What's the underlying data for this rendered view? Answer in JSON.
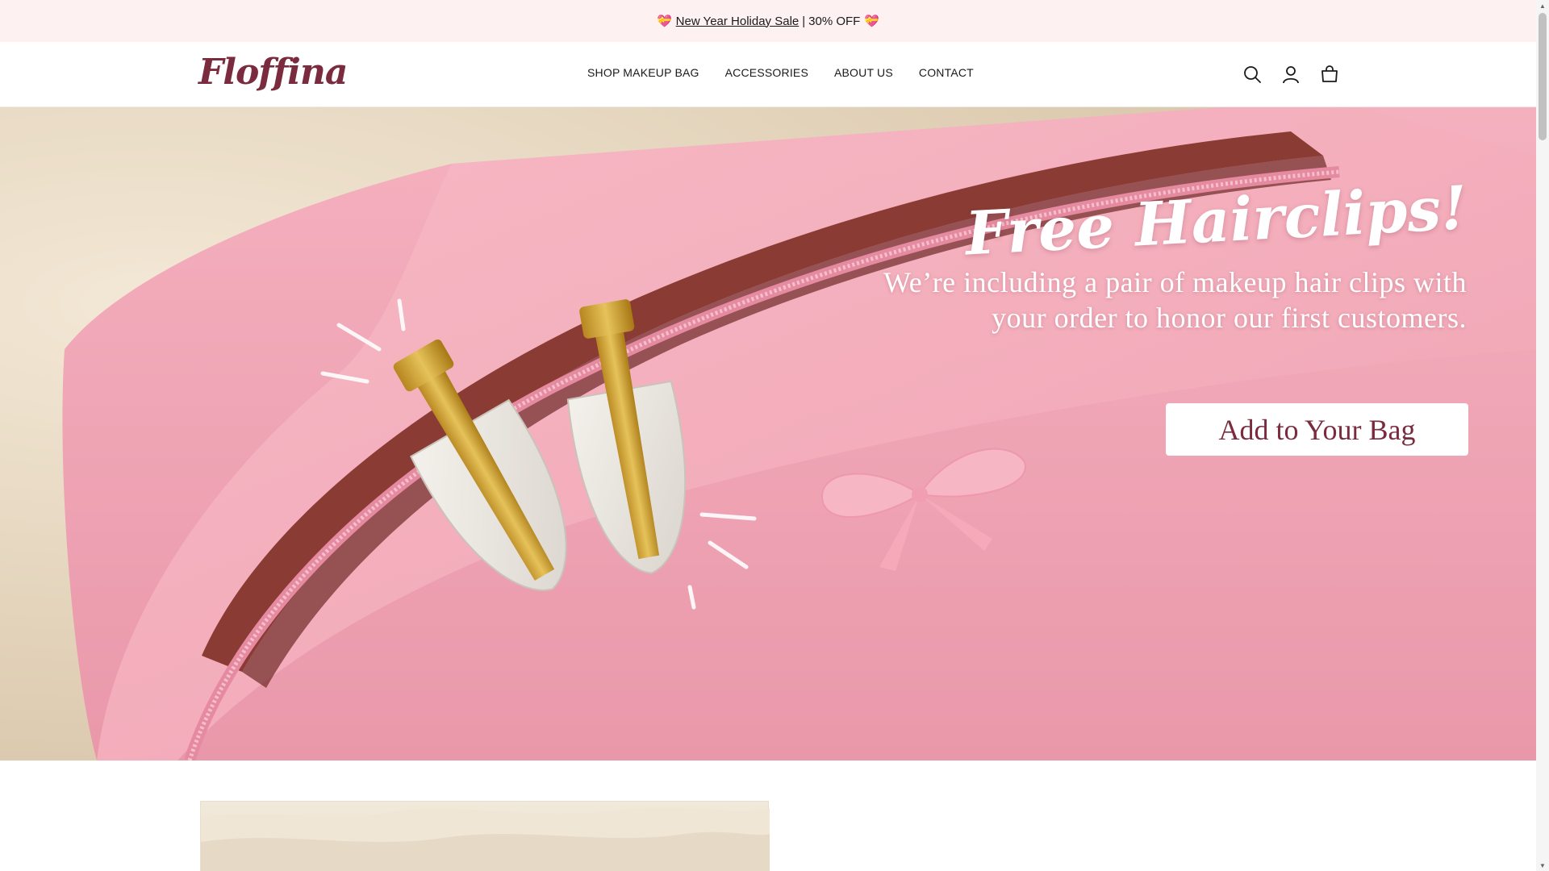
{
  "announcement": {
    "sale_link": "New Year Holiday Sale",
    "separator": "|",
    "discount": "30% OFF"
  },
  "header": {
    "logo": "Floffina",
    "nav": [
      {
        "label": "SHOP MAKEUP BAG"
      },
      {
        "label": "ACCESSORIES"
      },
      {
        "label": "ABOUT US"
      },
      {
        "label": "CONTACT"
      }
    ],
    "icons": [
      "search-icon",
      "account-icon",
      "cart-icon"
    ]
  },
  "hero": {
    "title": "Free Hairclips!",
    "subtitle": "We’re including a pair of makeup hair clips with your order to honor our first customers.",
    "button_label": "Add to Your Bag"
  },
  "colors": {
    "announcement_bg": "#fdf1f1",
    "brand": "#7a2b3e",
    "bag_pink": "#f2a9b7"
  }
}
